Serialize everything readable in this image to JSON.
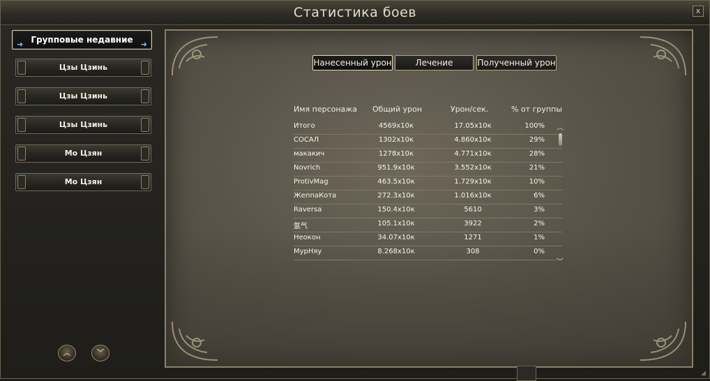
{
  "window": {
    "title": "Статистика боев",
    "close_label": "x"
  },
  "fights": {
    "group_label": "Групповые недавние",
    "items": [
      {
        "label": "Цзы Цзинь"
      },
      {
        "label": "Цзы Цзинь"
      },
      {
        "label": "Цзы Цзинь"
      },
      {
        "label": "Мо Цзян"
      },
      {
        "label": "Мо Цзян"
      }
    ],
    "scroll_up_icon": "chevron-up-icon",
    "scroll_down_icon": "chevron-down-icon"
  },
  "tabs": {
    "damage_dealt": "Нанесенный урон",
    "healing": "Лечение",
    "damage_taken": "Полученный урон",
    "active": "damage_dealt"
  },
  "table": {
    "headers": {
      "name": "Имя персонажа",
      "total": "Общий урон",
      "dps": "Урон/сек.",
      "pct": "% от группы"
    },
    "rows": [
      {
        "name": "Итого",
        "total": "4569x10к",
        "dps": "17.05x10к",
        "pct": "100%"
      },
      {
        "name": "СОСАЛ",
        "total": "1302x10к",
        "dps": "4.860x10к",
        "pct": "29%"
      },
      {
        "name": "макакич",
        "total": "1278x10к",
        "dps": "4.771x10к",
        "pct": "28%"
      },
      {
        "name": "Novrich",
        "total": "951.9x10к",
        "dps": "3.552x10к",
        "pct": "21%"
      },
      {
        "name": "ProtivMag",
        "total": "463.5x10к",
        "dps": "1.729x10к",
        "pct": "10%"
      },
      {
        "name": "ЖеппаКота",
        "total": "272.3x10к",
        "dps": "1.016x10к",
        "pct": "6%"
      },
      {
        "name": "Raversa",
        "total": "150.4x10к",
        "dps": "5610",
        "pct": "3%"
      },
      {
        "name": "氩气",
        "total": "105.1x10к",
        "dps": "3922",
        "pct": "2%"
      },
      {
        "name": "Неокон",
        "total": "34.07x10к",
        "dps": "1271",
        "pct": "1%"
      },
      {
        "name": "МурНяу",
        "total": "8.268x10к",
        "dps": "308",
        "pct": "0%"
      }
    ]
  },
  "colors": {
    "accent_border": "#cfcab8",
    "panel_border": "#8a8169",
    "text": "#f7f4ea"
  }
}
